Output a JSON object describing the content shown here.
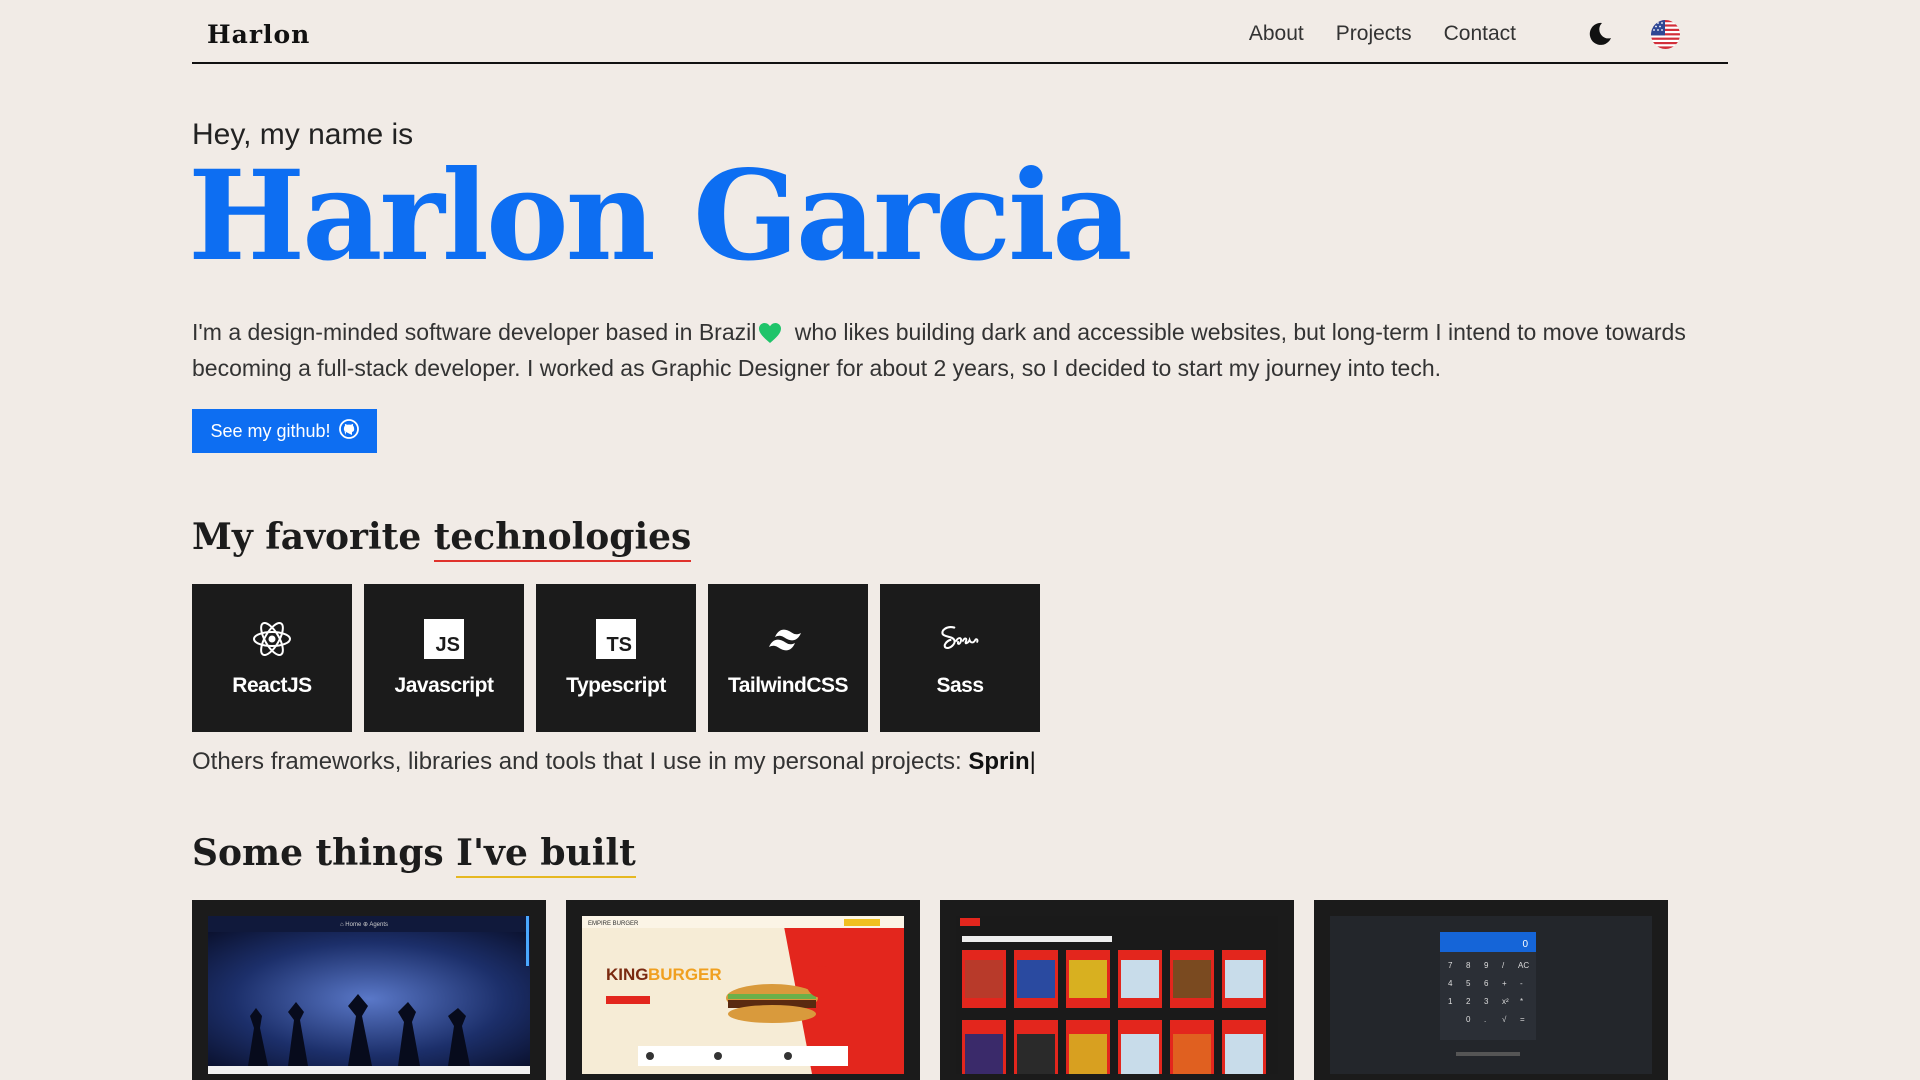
{
  "header": {
    "logo": "Harlon",
    "nav": [
      "About",
      "Projects",
      "Contact"
    ],
    "theme_icon": "moon-icon",
    "lang_icon": "us-flag-icon"
  },
  "hero": {
    "greeting": "Hey, my name is",
    "name": "Harlon Garcia",
    "bio_part1": "I'm a design-minded software developer based in Brazil",
    "bio_part2": " who likes building dark and accessible websites, but long-term I intend to move towards becoming a full-stack developer. I worked as Graphic Designer for about 2 years, so I decided to start my journey into tech.",
    "github_button": "See my github!"
  },
  "technologies": {
    "title_plain": "My favorite ",
    "title_underlined": "technologies",
    "items": [
      {
        "label": "ReactJS",
        "icon": "react-icon"
      },
      {
        "label": "Javascript",
        "icon": "javascript-icon",
        "badge": "JS"
      },
      {
        "label": "Typescript",
        "icon": "typescript-icon",
        "badge": "TS"
      },
      {
        "label": "TailwindCSS",
        "icon": "tailwind-icon"
      },
      {
        "label": "Sass",
        "icon": "sass-icon"
      }
    ],
    "others_text": "Others frameworks, libraries and tools that I use in my personal projects: ",
    "typed_text": "Sprin",
    "caret": "|"
  },
  "projects": {
    "title_plain": "Some things ",
    "title_underlined": "I've built"
  },
  "colors": {
    "background": "#f1ebe6",
    "accent": "#0d6ef2",
    "card": "#1b1b1b",
    "underline_red": "#e0322c",
    "underline_yellow": "#e6b822",
    "heart": "#1fc46a"
  }
}
